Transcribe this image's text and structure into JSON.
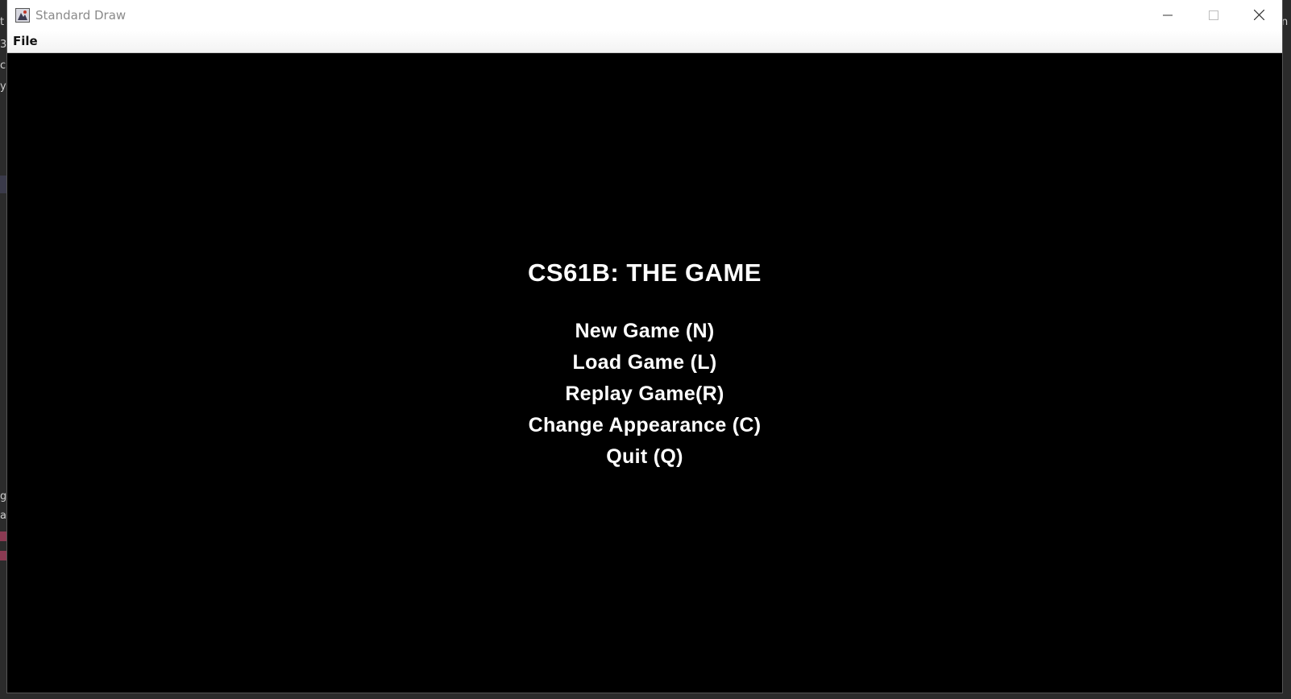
{
  "window": {
    "title": "Standard Draw",
    "icon": "java-app-icon",
    "controls": [
      "minimize-icon",
      "maximize-icon",
      "close-icon"
    ]
  },
  "menubar": {
    "file_label": "File"
  },
  "game": {
    "title": "CS61B: THE GAME",
    "options": [
      "New Game (N)",
      "Load Game (L)",
      "Replay Game(R)",
      "Change Appearance (C)",
      "Quit (Q)"
    ]
  },
  "colors": {
    "canvas": "#000000",
    "text": "#ffffff",
    "titlebar": "#ffffff",
    "title_text": "#8a8a8a"
  }
}
